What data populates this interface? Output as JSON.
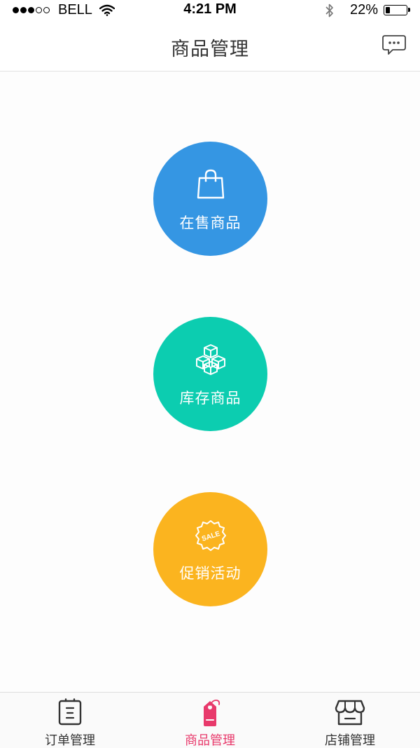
{
  "status_bar": {
    "carrier": "BELL",
    "time": "4:21 PM",
    "battery": "22%",
    "battery_level": 0.22,
    "signal_bars": 3,
    "signal_total": 5
  },
  "nav": {
    "title": "商品管理",
    "chat_icon": "chat-bubbles-icon"
  },
  "actions": [
    {
      "label": "在售商品",
      "icon": "shopping-bag-icon",
      "color": "#3596e3"
    },
    {
      "label": "库存商品",
      "icon": "stacked-boxes-icon",
      "color": "#0ccdb0"
    },
    {
      "label": "促销活动",
      "icon": "sale-badge-icon",
      "color": "#fbb41f",
      "icon_text": "SALE"
    }
  ],
  "tabs": [
    {
      "label": "订单管理",
      "icon": "order-clipboard-icon",
      "active": false
    },
    {
      "label": "商品管理",
      "icon": "price-tag-icon",
      "active": true
    },
    {
      "label": "店铺管理",
      "icon": "storefront-icon",
      "active": false
    }
  ],
  "colors": {
    "active_tab": "#e8396b",
    "inactive_tab": "#333333"
  }
}
